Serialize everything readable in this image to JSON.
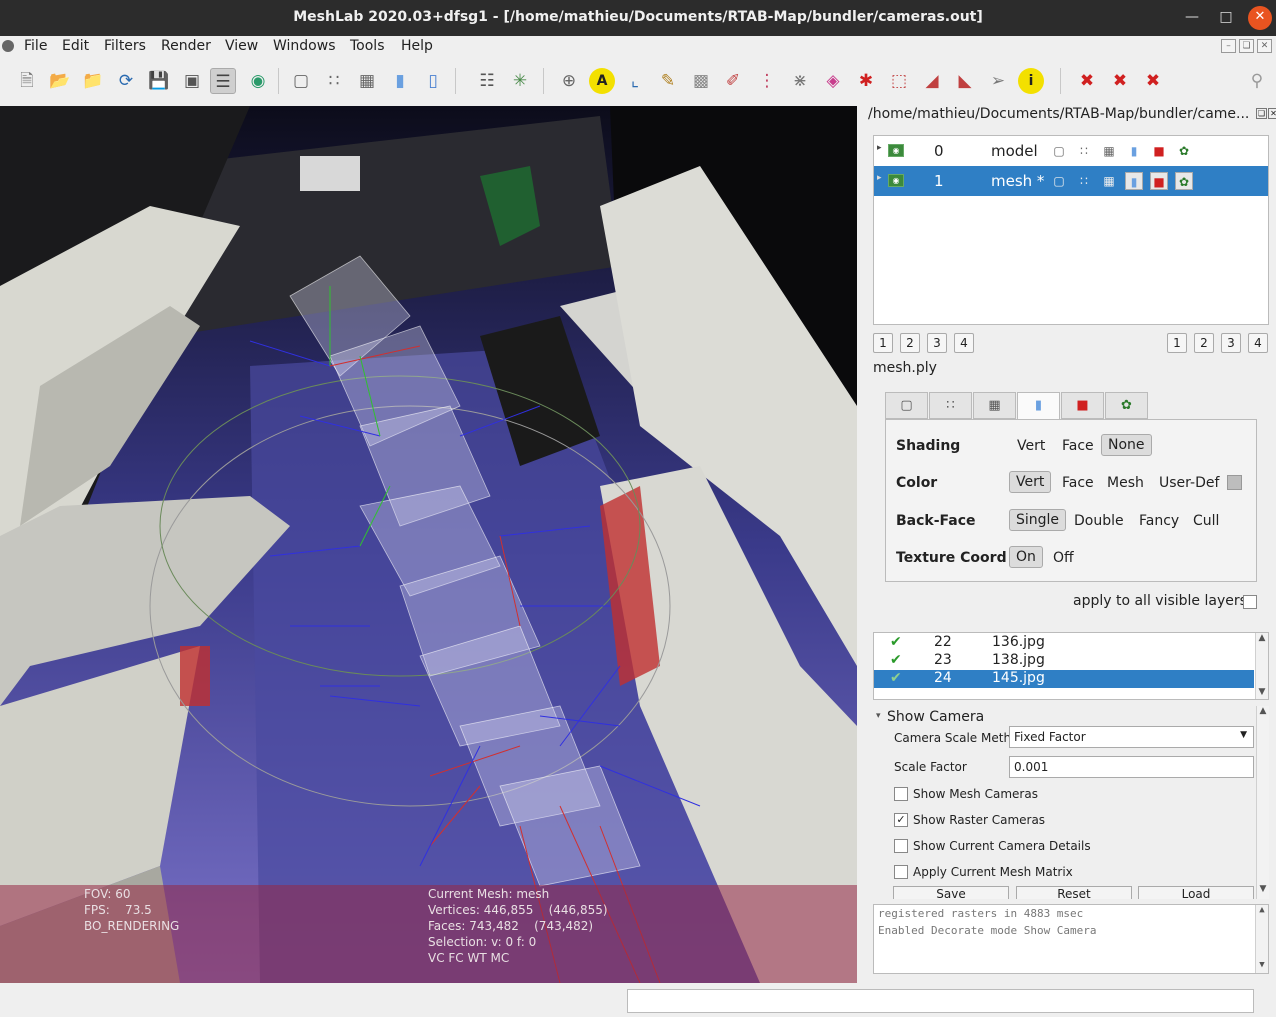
{
  "window": {
    "title": "MeshLab 2020.03+dfsg1 - [/home/mathieu/Documents/RTAB-Map/bundler/cameras.out]",
    "minimize_icon": "minimize-icon",
    "maximize_icon": "maximize-icon",
    "close_icon": "close-icon",
    "accent": "#e95420"
  },
  "menubar": {
    "items": [
      "File",
      "Edit",
      "Filters",
      "Render",
      "View",
      "Windows",
      "Tools",
      "Help"
    ]
  },
  "toolbar": {
    "icons": [
      "new-icon",
      "open-icon",
      "open-project-icon",
      "reload-icon",
      "save-icon",
      "snapshot-icon",
      "layers-icon",
      "globe-icon",
      "bbox-icon",
      "points-icon",
      "wireframe-icon",
      "flat-icon",
      "smooth-icon",
      "stack-icon",
      "axis-icon",
      "grid-icon",
      "label-icon",
      "measure-icon",
      "pick-icon",
      "camera-icon",
      "paint-icon",
      "select-icon",
      "align-icon",
      "color-icon",
      "georef-icon",
      "select-faces-icon",
      "select-verts-icon",
      "select-conn-icon",
      "select-free-icon",
      "info-icon",
      "delete-icon",
      "delete-faces-icon",
      "delete-verts-icon",
      "search-icon"
    ]
  },
  "viewport": {
    "info_left": [
      "FOV: 60",
      "FPS:    73.5",
      "BO_RENDERING"
    ],
    "info_right": [
      "Current Mesh: mesh",
      "Vertices: 446,855    (446,855)",
      "Faces: 743,482    (743,482)",
      "Selection: v: 0 f: 0",
      "VC FC WT MC"
    ]
  },
  "panel": {
    "header": "/home/mathieu/Documents/RTAB-Map/bundler/came...",
    "layers": [
      {
        "num": "0",
        "name": "model",
        "selected": false
      },
      {
        "num": "1",
        "name": "mesh *",
        "selected": true
      }
    ],
    "page_buttons_left": [
      "1",
      "2",
      "3",
      "4"
    ],
    "page_buttons_right": [
      "1",
      "2",
      "3",
      "4"
    ],
    "mesh_file": "mesh.ply"
  },
  "render": {
    "shading": {
      "label": "Shading",
      "options": [
        "Vert",
        "Face",
        "None"
      ],
      "selected": "None"
    },
    "color": {
      "label": "Color",
      "options": [
        "Vert",
        "Face",
        "Mesh",
        "User-Def"
      ],
      "selected": "Vert"
    },
    "backface": {
      "label": "Back-Face",
      "options": [
        "Single",
        "Double",
        "Fancy",
        "Cull"
      ],
      "selected": "Single"
    },
    "texcoord": {
      "label": "Texture Coord",
      "options": [
        "On",
        "Off"
      ],
      "selected": "On"
    },
    "apply_all": "apply to all visible layers"
  },
  "rasters": [
    {
      "num": "22",
      "name": "136.jpg",
      "selected": false
    },
    {
      "num": "23",
      "name": "138.jpg",
      "selected": false
    },
    {
      "num": "24",
      "name": "145.jpg",
      "selected": true
    }
  ],
  "decorator": {
    "title": "Show Camera",
    "scale_method_label": "Camera Scale Method",
    "scale_method_value": "Fixed Factor",
    "scale_factor_label": "Scale Factor",
    "scale_factor_value": "0.001",
    "checkboxes": [
      {
        "label": "Show Mesh Cameras",
        "checked": false
      },
      {
        "label": "Show Raster Cameras",
        "checked": true
      },
      {
        "label": "Show Current Camera Details",
        "checked": false
      },
      {
        "label": "Apply Current Mesh Matrix",
        "checked": false
      }
    ],
    "buttons": [
      "Save",
      "Reset",
      "Load"
    ]
  },
  "log": [
    "registered rasters in 4883 msec",
    "Enabled Decorate mode Show Camera"
  ]
}
